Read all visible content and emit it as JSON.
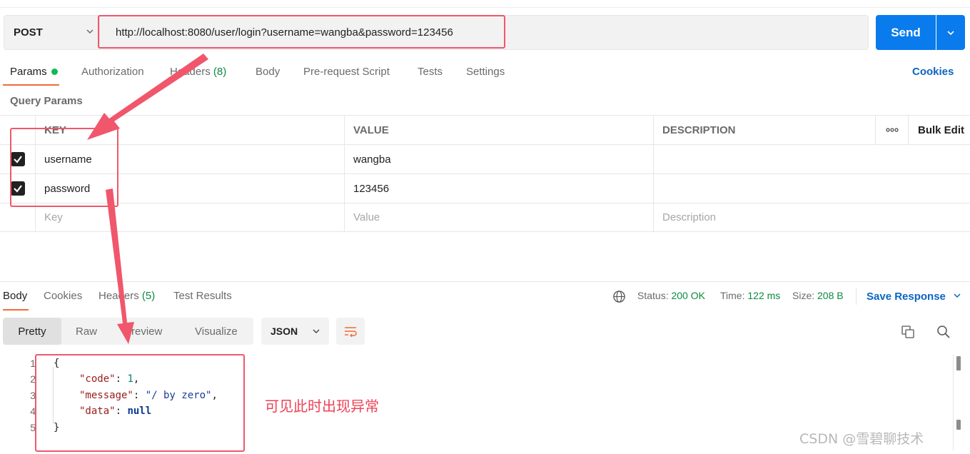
{
  "request": {
    "method": "POST",
    "url": "http://localhost:8080/user/login?username=wangba&password=123456",
    "send_label": "Send"
  },
  "request_tabs": [
    {
      "label": "Params",
      "active": true,
      "dot": true
    },
    {
      "label": "Authorization",
      "active": false
    },
    {
      "label": "Headers",
      "count": "(8)",
      "active": false
    },
    {
      "label": "Body",
      "active": false
    },
    {
      "label": "Pre-request Script",
      "active": false
    },
    {
      "label": "Tests",
      "active": false
    },
    {
      "label": "Settings",
      "active": false
    }
  ],
  "cookies_link": "Cookies",
  "query_params": {
    "title": "Query Params",
    "headers": {
      "key": "KEY",
      "value": "VALUE",
      "description": "DESCRIPTION",
      "more": "ooo",
      "bulk_edit": "Bulk Edit"
    },
    "rows": [
      {
        "checked": true,
        "key": "username",
        "value": "wangba",
        "description": ""
      },
      {
        "checked": true,
        "key": "password",
        "value": "123456",
        "description": ""
      }
    ],
    "placeholder": {
      "key": "Key",
      "value": "Value",
      "description": "Description"
    }
  },
  "response_tabs": [
    {
      "label": "Body",
      "active": true
    },
    {
      "label": "Cookies",
      "active": false
    },
    {
      "label": "Headers",
      "count": "(5)",
      "active": false
    },
    {
      "label": "Test Results",
      "active": false
    }
  ],
  "status": {
    "status_label": "Status:",
    "status_value": "200 OK",
    "time_label": "Time:",
    "time_value": "122 ms",
    "size_label": "Size:",
    "size_value": "208 B"
  },
  "save_response": "Save Response",
  "format_tabs": [
    "Pretty",
    "Raw",
    "Preview",
    "Visualize"
  ],
  "format_active": "Pretty",
  "language": "JSON",
  "code": {
    "line_numbers": [
      "1",
      "2",
      "3",
      "4",
      "5"
    ],
    "open_brace": "{",
    "close_brace": "}",
    "entries": [
      {
        "key": "\"code\"",
        "value": "1",
        "type": "number",
        "comma": ","
      },
      {
        "key": "\"message\"",
        "value": "\"/ by zero\"",
        "type": "string",
        "comma": ","
      },
      {
        "key": "\"data\"",
        "value": "null",
        "type": "null",
        "comma": ""
      }
    ]
  },
  "annotation_note": "可见此时出现异常",
  "watermark": "CSDN @雪碧聊技术",
  "colors": {
    "accent_orange": "#f26b3a",
    "send_blue": "#097bed",
    "link_blue": "#0b65c2",
    "status_green": "#0c8a3f",
    "annotation_red": "#f0576c"
  }
}
